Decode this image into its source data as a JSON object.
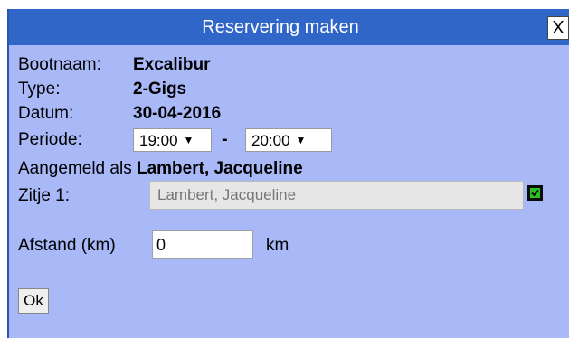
{
  "dialog": {
    "title": "Reservering maken",
    "close_label": "X"
  },
  "boat": {
    "name_label": "Bootnaam:",
    "name_value": "Excalibur",
    "type_label": "Type:",
    "type_value": "2-Gigs",
    "date_label": "Datum:",
    "date_value": "30-04-2016"
  },
  "period": {
    "label": "Periode:",
    "start": "19:00",
    "separator": "-",
    "end": "20:00"
  },
  "logged_in": {
    "prefix": "Aangemeld als",
    "name": "Lambert, Jacqueline"
  },
  "seat": {
    "label": "Zitje 1:",
    "value": "Lambert, Jacqueline",
    "checked": true
  },
  "distance": {
    "label": "Afstand (km)",
    "value": "0",
    "unit": "km"
  },
  "ok_label": "Ok",
  "colors": {
    "titlebar": "#3166c9",
    "background": "#a9b8f7",
    "checkbox": "#27c21f"
  }
}
